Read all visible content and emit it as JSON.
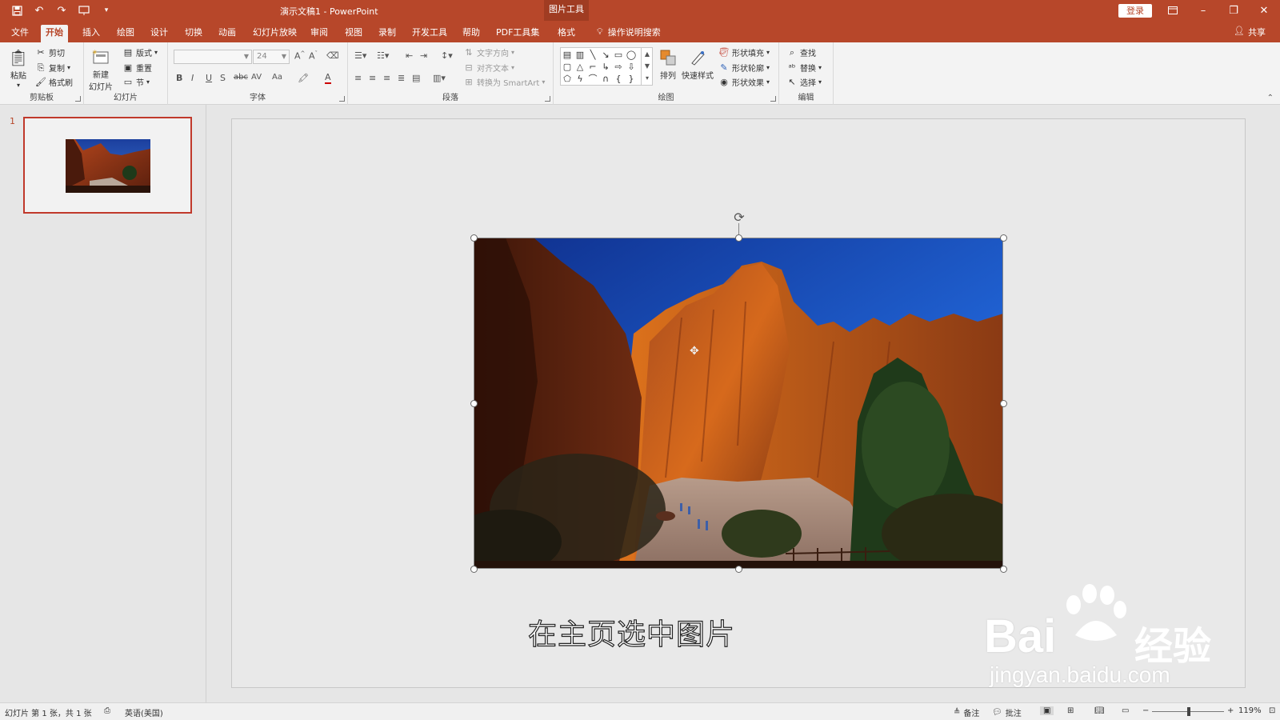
{
  "window": {
    "title": "演示文稿1  -  PowerPoint",
    "context_group": "图片工具",
    "login_label": "登录",
    "share_label": "共享",
    "tell_me": "操作说明搜索"
  },
  "tabs": [
    {
      "label": "文件",
      "active": false
    },
    {
      "label": "开始",
      "active": true
    },
    {
      "label": "插入",
      "active": false
    },
    {
      "label": "绘图",
      "active": false
    },
    {
      "label": "设计",
      "active": false
    },
    {
      "label": "切换",
      "active": false
    },
    {
      "label": "动画",
      "active": false
    },
    {
      "label": "幻灯片放映",
      "active": false
    },
    {
      "label": "审阅",
      "active": false
    },
    {
      "label": "视图",
      "active": false
    },
    {
      "label": "录制",
      "active": false
    },
    {
      "label": "开发工具",
      "active": false
    },
    {
      "label": "帮助",
      "active": false
    },
    {
      "label": "PDF工具集",
      "active": false
    },
    {
      "label": "格式",
      "active": false
    }
  ],
  "ribbon": {
    "clipboard": {
      "label": "剪贴板",
      "paste": "粘贴",
      "cut": "剪切",
      "copy": "复制",
      "format_painter": "格式刷"
    },
    "slides": {
      "label": "幻灯片",
      "new_slide_line1": "新建",
      "new_slide_line2": "幻灯片",
      "layout": "版式",
      "reset": "重置",
      "section": "节"
    },
    "font": {
      "label": "字体",
      "font_name": "",
      "font_size": "24",
      "bold": "B",
      "italic": "I",
      "underline": "U",
      "shadow": "S",
      "strike": "abc",
      "spacing": "AV",
      "case": "Aa",
      "color": "A"
    },
    "paragraph": {
      "label": "段落",
      "text_direction": "文字方向",
      "align_text": "对齐文本",
      "convert_smartart": "转换为 SmartArt"
    },
    "drawing": {
      "label": "绘图",
      "arrange": "排列",
      "quick_styles": "快速样式",
      "shape_fill": "形状填充",
      "shape_outline": "形状轮廓",
      "shape_effects": "形状效果"
    },
    "editing": {
      "label": "编辑",
      "find": "查找",
      "replace": "替换",
      "select": "选择"
    }
  },
  "thumbnail": {
    "number": "1"
  },
  "slide": {
    "caption": "在主页选中图片"
  },
  "watermark": {
    "brand": "Bai",
    "brand_suffix": "经验",
    "url": "jingyan.baidu.com"
  },
  "status": {
    "slide_info": "幻灯片 第 1 张，共 1 张",
    "language": "英语(美国)",
    "notes": "备注",
    "comments": "批注",
    "zoom": "119%"
  },
  "icons": {
    "save": "save-icon",
    "undo": "undo-icon",
    "redo": "redo-icon",
    "start_from_beginning": "present-icon"
  }
}
